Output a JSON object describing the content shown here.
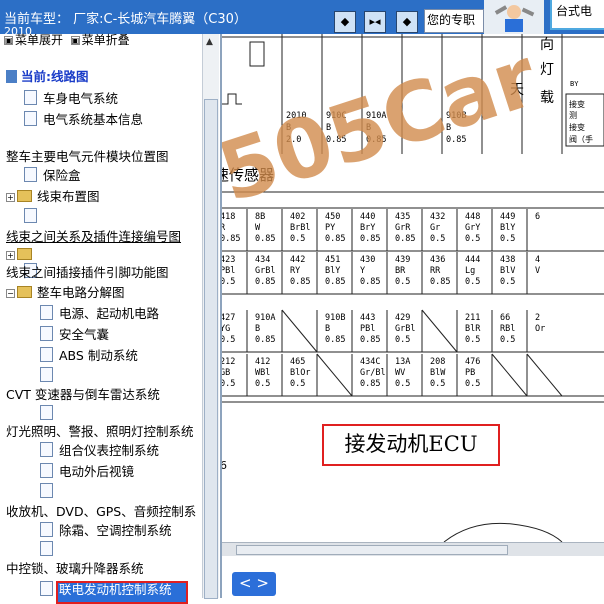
{
  "header": {
    "title": "当前车型： 厂家:C-长城汽车腾翼（C30）",
    "title_line2": "2010",
    "hint_text": "您的专职",
    "logo_icon": "mechanic-icon",
    "corner_text": "台式电"
  },
  "nav_buttons": [
    "◆",
    "▸◂",
    "◆"
  ],
  "menu": {
    "expand_label": "菜单展开",
    "collapse_label": "菜单折叠"
  },
  "tree": {
    "current": "当前:线路图",
    "items": [
      "车身电气系统",
      "电气系统基本信息",
      "整车主要电气元件模块位置图",
      "保险盒",
      "线束布置图",
      "线束之间关系及插件连接编号图",
      "",
      "线束之间插接插件引脚功能图",
      "整车电路分解图",
      "电源、起动机电路",
      "安全气囊",
      "ABS 制动系统",
      "CVT 变速器与倒车雷达系统",
      "灯光照明、警报、照明灯控制系统",
      "组合仪表控制系统",
      "电动外后视镜",
      "",
      "收放机、DVD、GPS、音频控制系",
      "除霜、空调控制系统",
      "",
      "中控锁、玻璃升降器系统",
      "联电发动机控制系统"
    ]
  },
  "diagram": {
    "ecu_label": "接发动机ECU",
    "sensor_label": "速传感器",
    "side_number": "6",
    "top_rows": [
      [
        "2010",
        "910C",
        "910A",
        "910B"
      ],
      [
        "B",
        "B",
        "B",
        "B"
      ],
      [
        "2.0",
        "0.85",
        "0.85",
        "0.85"
      ]
    ],
    "row1": [
      [
        "418",
        "R",
        "0.85"
      ],
      [
        "8B",
        "W",
        "0.85"
      ],
      [
        "402",
        "BrBl",
        "0.5"
      ],
      [
        "450",
        "PY",
        "0.85"
      ],
      [
        "440",
        "BrY",
        "0.85"
      ],
      [
        "435",
        "GrR",
        "0.85"
      ],
      [
        "432",
        "Gr",
        "0.5"
      ],
      [
        "448",
        "GrY",
        "0.5"
      ],
      [
        "449",
        "BlY",
        "0.5"
      ],
      [
        "6",
        "",
        ""
      ]
    ],
    "row2": [
      [
        "423",
        "PBl",
        "0.5"
      ],
      [
        "434",
        "GrBl",
        "0.85"
      ],
      [
        "442",
        "RY",
        "0.85"
      ],
      [
        "451",
        "BlY",
        "0.85"
      ],
      [
        "430",
        "Y",
        "0.85"
      ],
      [
        "439",
        "BR",
        "0.5"
      ],
      [
        "436",
        "RR",
        "0.85"
      ],
      [
        "444",
        "Lg",
        "0.5"
      ],
      [
        "438",
        "BlV",
        "0.5"
      ],
      [
        "4",
        "V",
        ""
      ]
    ],
    "row3": [
      [
        "427",
        "YG",
        "0.5"
      ],
      [
        "910A",
        "B",
        "0.85"
      ],
      [
        "",
        "",
        ""
      ],
      [
        "910B",
        "B",
        "0.85"
      ],
      [
        "443",
        "PBl",
        "0.85"
      ],
      [
        "429",
        "GrBl",
        "0.5"
      ],
      [
        "",
        "",
        ""
      ],
      [
        "211",
        "BlR",
        "0.5"
      ],
      [
        "66",
        "RBl",
        "0.5"
      ],
      [
        "2",
        "Or",
        ""
      ]
    ],
    "row4": [
      [
        "212",
        "GB",
        "0.5"
      ],
      [
        "412",
        "WBl",
        "0.5"
      ],
      [
        "465",
        "BlOr",
        "0.5"
      ],
      [
        "",
        "",
        ""
      ],
      [
        "434C",
        "Gr/Bl",
        "0.85"
      ],
      [
        "13A",
        "WV",
        "0.5"
      ],
      [
        "208",
        "BlW",
        "0.5"
      ],
      [
        "476",
        "PB",
        "0.5"
      ],
      [
        "",
        "",
        ""
      ],
      [
        "",
        "",
        ""
      ]
    ],
    "right_notes": [
      "接变",
      "测",
      "接变",
      "阀（手"
    ],
    "vertical_marks": [
      "向",
      "灯",
      "天",
      "载"
    ]
  },
  "watermark": "505Car",
  "pager_label": "< >"
}
